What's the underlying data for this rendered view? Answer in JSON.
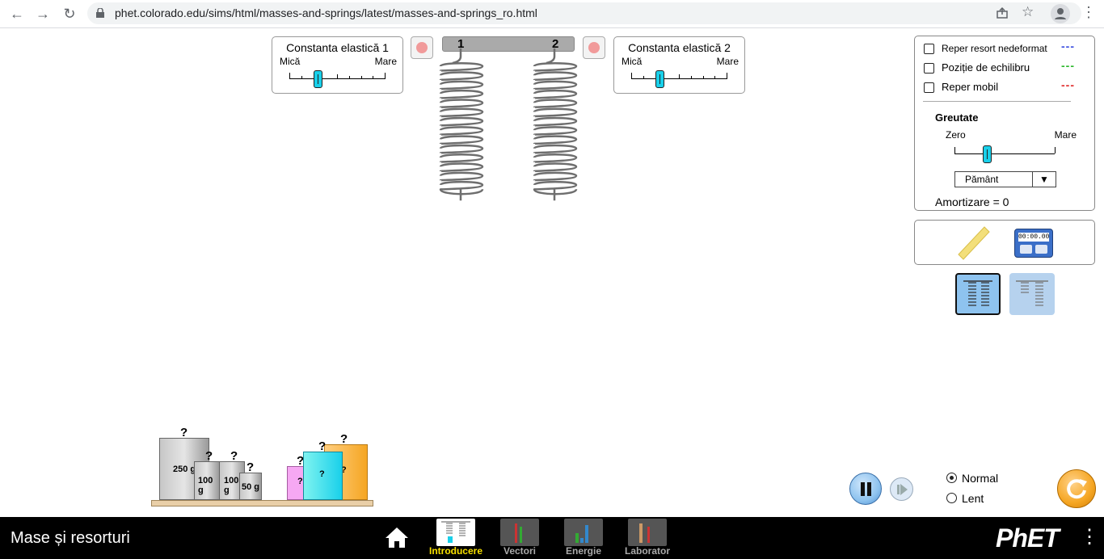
{
  "browser": {
    "url": "phet.colorado.edu/sims/html/masses-and-springs/latest/masses-and-springs_ro.html"
  },
  "spring1_panel": {
    "title": "Constanta elastică 1",
    "min_label": "Mică",
    "max_label": "Mare",
    "value": 0.3
  },
  "spring2_panel": {
    "title": "Constanta elastică 2",
    "min_label": "Mică",
    "max_label": "Mare",
    "value": 0.3
  },
  "springs": {
    "label1": "1",
    "label2": "2"
  },
  "options": {
    "natural_length": {
      "label": "Reper resort nedeformat",
      "dash_color": "#3b4fe0",
      "checked": false
    },
    "equilibrium": {
      "label": "Poziție de echilibru",
      "dash_color": "#2db82d",
      "checked": false
    },
    "movable": {
      "label": "Reper mobil",
      "dash_color": "#e02b2b",
      "checked": false
    },
    "gravity": {
      "title": "Greutate",
      "min_label": "Zero",
      "max_label": "Mare",
      "value": 0.33,
      "planet": "Pământ"
    },
    "damping": "Amortizare = 0"
  },
  "tools": {
    "stopwatch_time": "00:00.00"
  },
  "masses": {
    "m250": "250 g",
    "m100a": "100 g",
    "m100b": "100 g",
    "m50": "50 g",
    "unknown": "?"
  },
  "playback": {
    "normal_label": "Normal",
    "slow_label": "Lent",
    "selected": "Normal"
  },
  "footer": {
    "title": "Mase și resorturi",
    "screens": [
      "Introducere",
      "Vectori",
      "Energie",
      "Laborator"
    ],
    "active_screen": "Introducere",
    "logo": "PhET"
  },
  "colors": {
    "accent_cyan": "#19d0ea",
    "reset_orange": "#f5a623",
    "pause_blue": "#8ec3ef"
  }
}
